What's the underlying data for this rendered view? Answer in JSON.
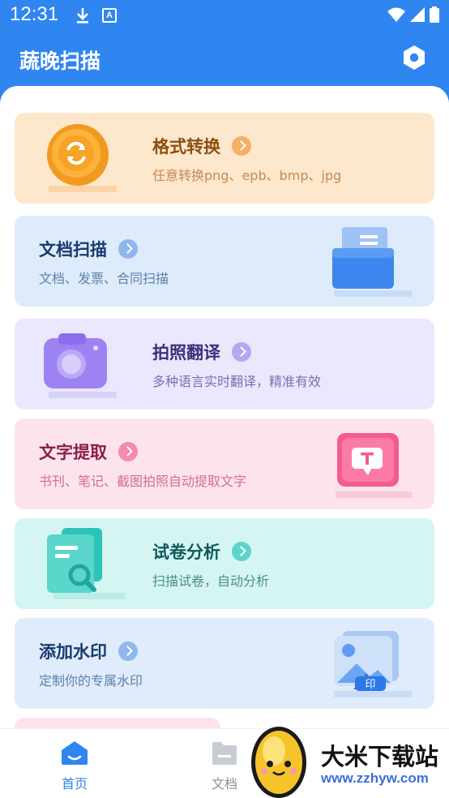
{
  "status_bar": {
    "time": "12:31"
  },
  "header": {
    "title": "蔬晚扫描"
  },
  "cards": [
    {
      "title": "格式转换",
      "subtitle": "任意转换png、epb、bmp、jpg"
    },
    {
      "title": "文档扫描",
      "subtitle": "文档、发票、合同扫描"
    },
    {
      "title": "拍照翻译",
      "subtitle": "多种语言实时翻译，精准有效"
    },
    {
      "title": "文字提取",
      "subtitle": "书刊、笔记、截图拍照自动提取文字"
    },
    {
      "title": "试卷分析",
      "subtitle": "扫描试卷，自动分析"
    },
    {
      "title": "添加水印",
      "subtitle": "定制你的专属水印"
    }
  ],
  "bottom_nav": {
    "home": "首页",
    "docs": "文档"
  },
  "watermark": {
    "name": "大米下载站",
    "url": "www.zzhyw.com"
  },
  "colors": {
    "brand": "#2f86f0"
  }
}
